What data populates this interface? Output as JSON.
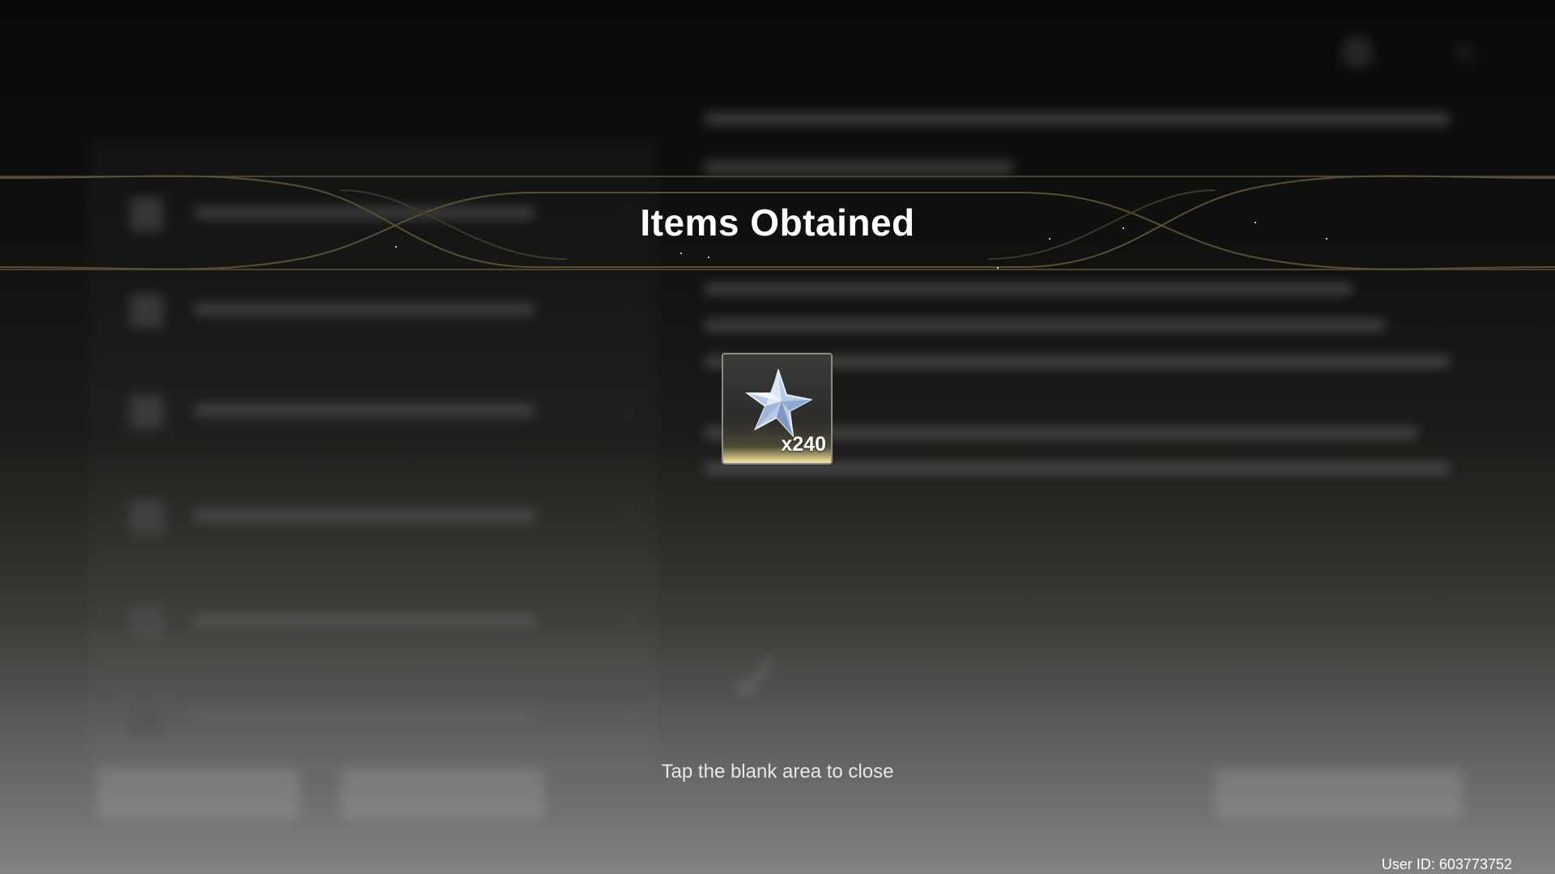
{
  "modal": {
    "title": "Items Obtained",
    "close_hint": "Tap the blank area to close"
  },
  "reward": {
    "icon": "crystal-star-icon",
    "quantity": "x240"
  },
  "footer": {
    "user_id": "User ID: 603773752"
  },
  "colors": {
    "banner_line": "#5a4e34",
    "card_glow": "#f1e6b0"
  }
}
